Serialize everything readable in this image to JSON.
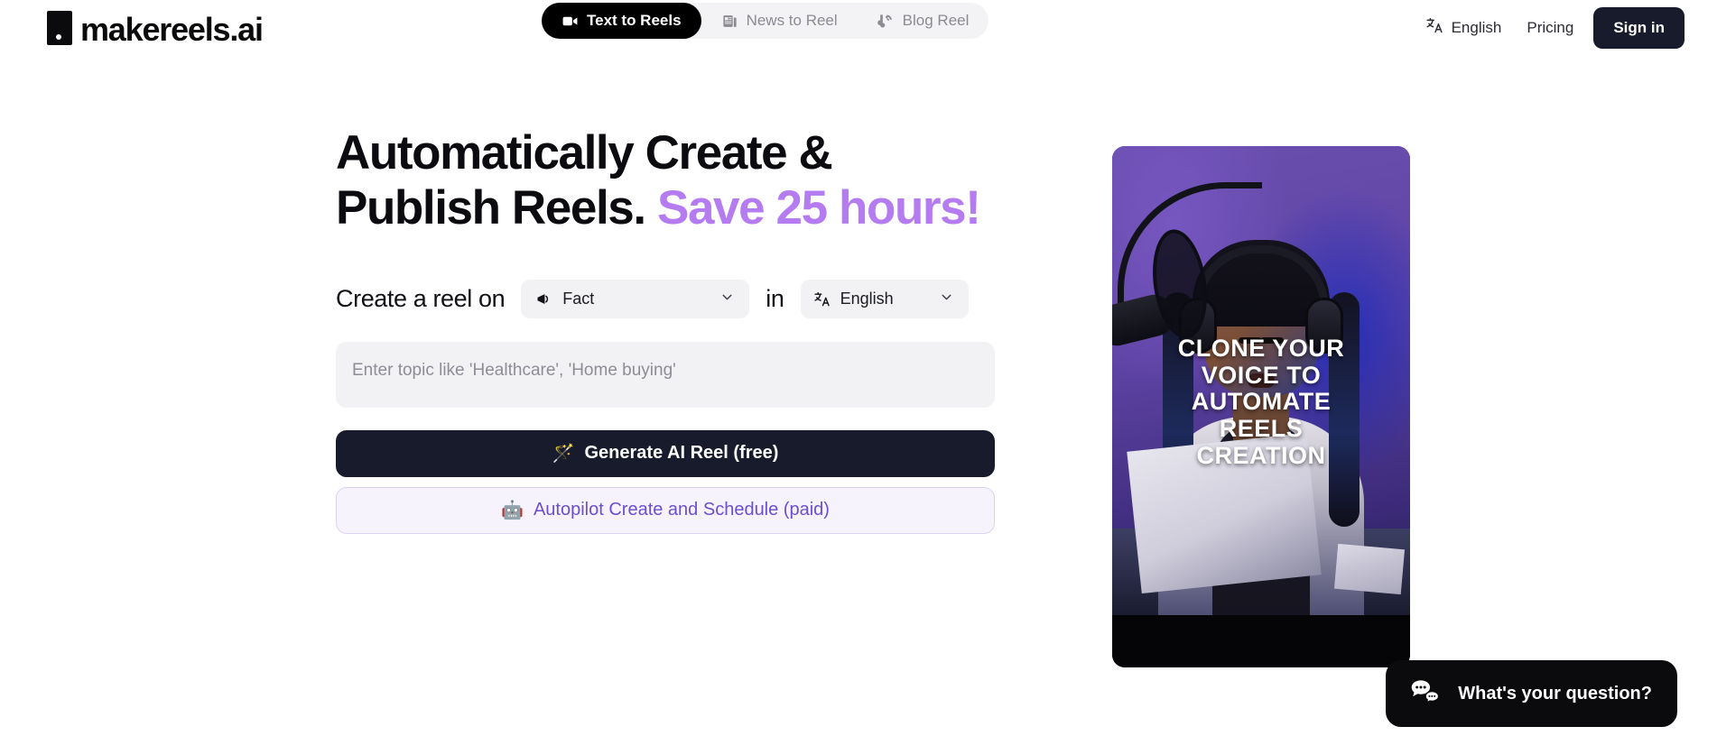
{
  "header": {
    "logo_text": "makereels.ai",
    "logo_icon": "reel-square-logo",
    "tabs": [
      {
        "label": "Text to Reels",
        "icon": "video-camera-icon",
        "active": true
      },
      {
        "label": "News to Reel",
        "icon": "newspaper-icon",
        "active": false
      },
      {
        "label": "Blog Reel",
        "icon": "blogger-rss-icon",
        "active": false
      }
    ],
    "language_label": "English",
    "language_icon": "translate-icon",
    "pricing_label": "Pricing",
    "signin_label": "Sign in",
    "signin_bg": "#171b2c"
  },
  "hero": {
    "headline_part1": "Automatically Create & Publish Reels.",
    "headline_accent": "Save 25 hours!",
    "accent_color": "#b57bf0"
  },
  "form": {
    "prefix_label": "Create a reel on",
    "topic_type": {
      "value": "Fact",
      "icon": "megaphone-icon",
      "chevron": "chevron-down-icon"
    },
    "join_label": "in",
    "language": {
      "value": "English",
      "icon": "translate-icon",
      "chevron": "chevron-down-icon"
    },
    "topic_placeholder": "Enter topic like 'Healthcare', 'Home buying'",
    "topic_value": "",
    "primary_button": {
      "label": "Generate AI Reel (free)",
      "icon": "magic-wand-icon",
      "bg": "#171b2c"
    },
    "secondary_button": {
      "label": "Autopilot Create and Schedule (paid)",
      "icon": "robot-icon",
      "bg": "#f6f3fd",
      "color": "#6b4fd0"
    }
  },
  "video_preview": {
    "caption": "CLONE YOUR VOICE TO AUTOMATE REELS CREATION",
    "caption_lines": [
      "CLONE YOUR",
      "VOICE TO",
      "AUTOMATE",
      "REELS",
      "CREATION"
    ],
    "description": "Woman with headphones speaking into a studio microphone while reading a script, purple and blue studio lighting"
  },
  "chat_widget": {
    "label": "What's your question?",
    "icon": "chat-bubbles-icon",
    "bg": "#0b0b0d"
  }
}
